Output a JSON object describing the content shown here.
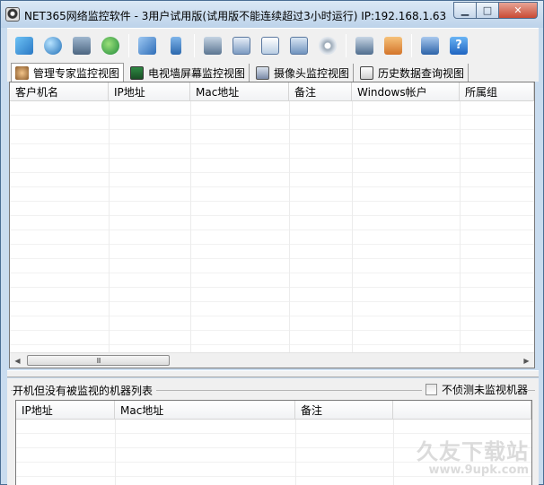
{
  "window": {
    "title": "NET365网络监控软件 - 3用户试用版(试用版不能连续超过3小时运行) IP:192.168.1.63",
    "min_glyph": "▁",
    "max_glyph": "□",
    "close_glyph": "✕"
  },
  "toolbar": {
    "buttons": [
      {
        "icon": "layers-icon",
        "color": "#3a8fd6"
      },
      {
        "icon": "globe-icon",
        "color": "#2f86c9"
      },
      {
        "icon": "monitor-settings-icon",
        "color": "#5a6f86"
      },
      {
        "icon": "users-icon",
        "color": "#2aa34a"
      },
      {
        "icon": "network-edit-icon",
        "color": "#3f7bd0"
      },
      {
        "icon": "usb-icon",
        "color": "#3778c4"
      },
      {
        "icon": "computer-icon",
        "color": "#4d6a8a"
      },
      {
        "icon": "mail-icon",
        "color": "#4e7fb8"
      },
      {
        "icon": "search-document-icon",
        "color": "#2f6fb3"
      },
      {
        "icon": "windows-icon",
        "color": "#5581b5"
      },
      {
        "icon": "disc-icon",
        "color": "#7e8c9c"
      },
      {
        "icon": "server-icon",
        "color": "#4b6b8d"
      },
      {
        "icon": "user-profile-icon",
        "color": "#e08a2c"
      },
      {
        "icon": "shopping-cart-icon",
        "color": "#2f6fb3"
      },
      {
        "icon": "help-icon",
        "color": "#2f7fd6"
      }
    ]
  },
  "tabs": [
    {
      "label": "管理专家监控视图",
      "icon": "expert-icon",
      "color": "#8a5a2a",
      "active": true
    },
    {
      "label": "电视墙屏幕监控视图",
      "icon": "tv-wall-icon",
      "color": "#2a7a3a",
      "active": false
    },
    {
      "label": "摄像头监控视图",
      "icon": "camera-icon",
      "color": "#6a7a9a",
      "active": false
    },
    {
      "label": "历史数据查询视图",
      "icon": "history-icon",
      "color": "#4a4a4a",
      "active": false
    }
  ],
  "main_table": {
    "columns": [
      "客户机名",
      "IP地址",
      "Mac地址",
      "备注",
      "Windows帐户",
      "所属组"
    ]
  },
  "scrollbar": {
    "left_arrow": "◀",
    "right_arrow": "▶",
    "thumb_grip": "III"
  },
  "lower_panel": {
    "title": "开机但没有被监视的机器列表",
    "checkbox_label": "不侦测未监视机器",
    "checkbox_checked": false,
    "columns": [
      "IP地址",
      "Mac地址",
      "备注",
      ""
    ]
  },
  "watermark": {
    "line1": "久友下载站",
    "line2": "www.9upk.com"
  }
}
